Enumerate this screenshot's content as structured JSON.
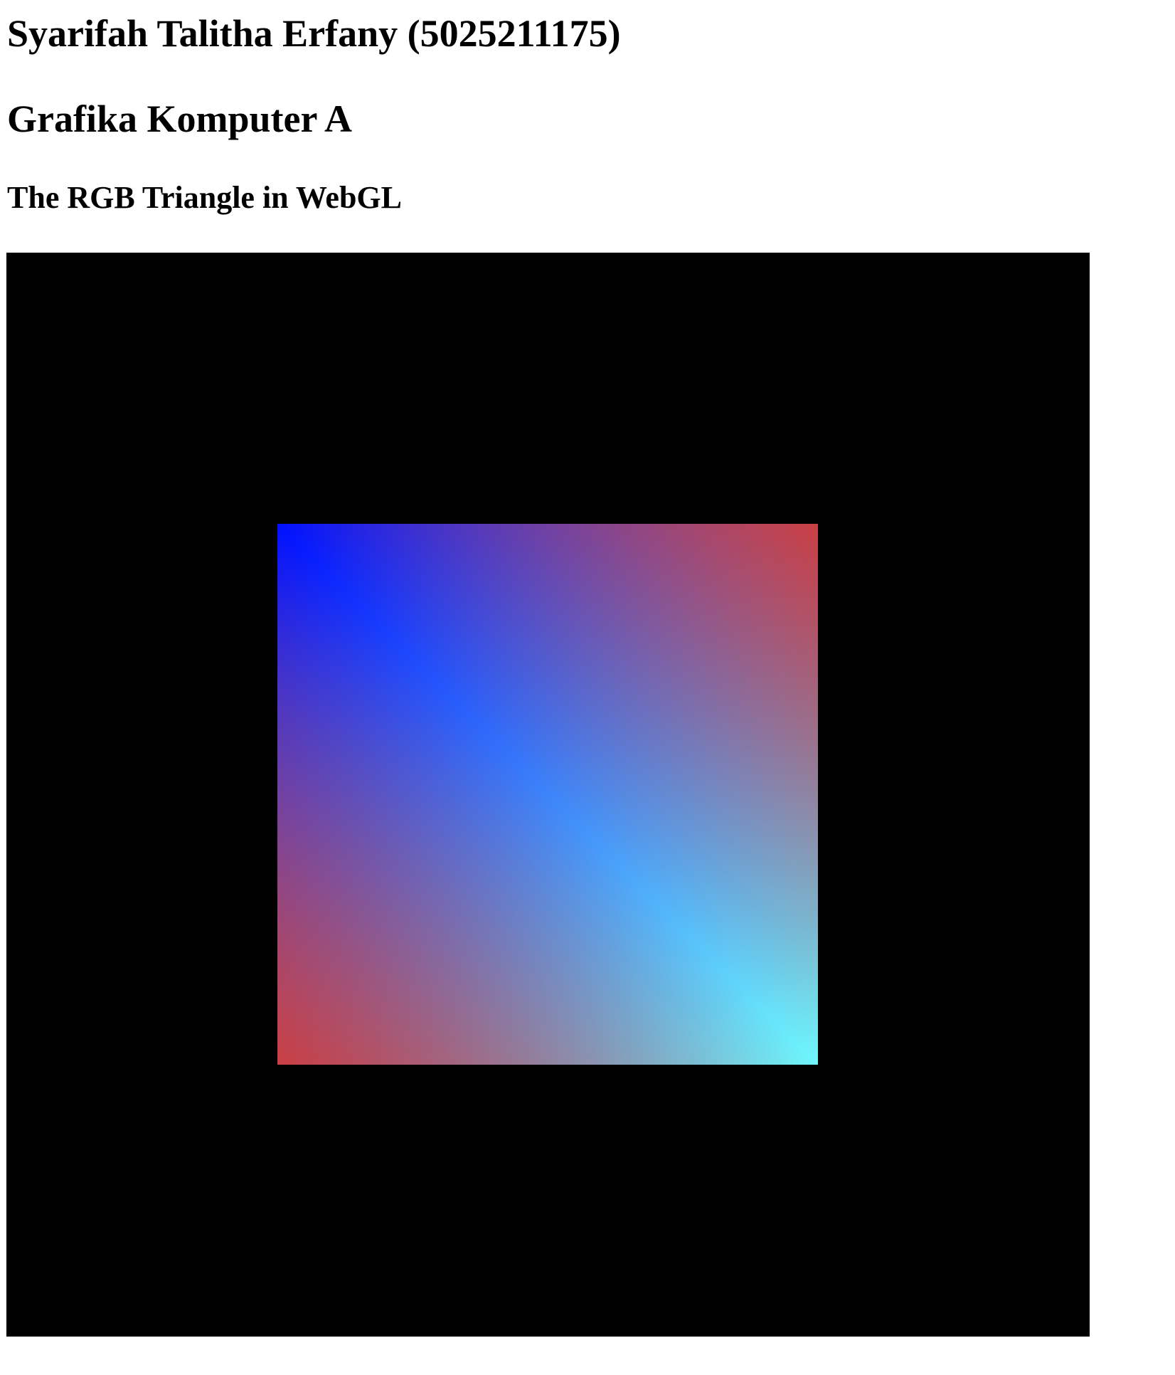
{
  "headings": {
    "name": "Syarifah Talitha Erfany (5025211175)",
    "course": "Grafika Komputer A",
    "subtitle": "The RGB Triangle in WebGL"
  },
  "canvas": {
    "background_color": "#000000",
    "shape": "square",
    "corner_colors": {
      "top_left": "#0010ff",
      "top_right": "#e33323",
      "bottom_left": "#e33323",
      "bottom_right": "#6ff8fb",
      "center_diagonal": "#3c84fa"
    }
  }
}
